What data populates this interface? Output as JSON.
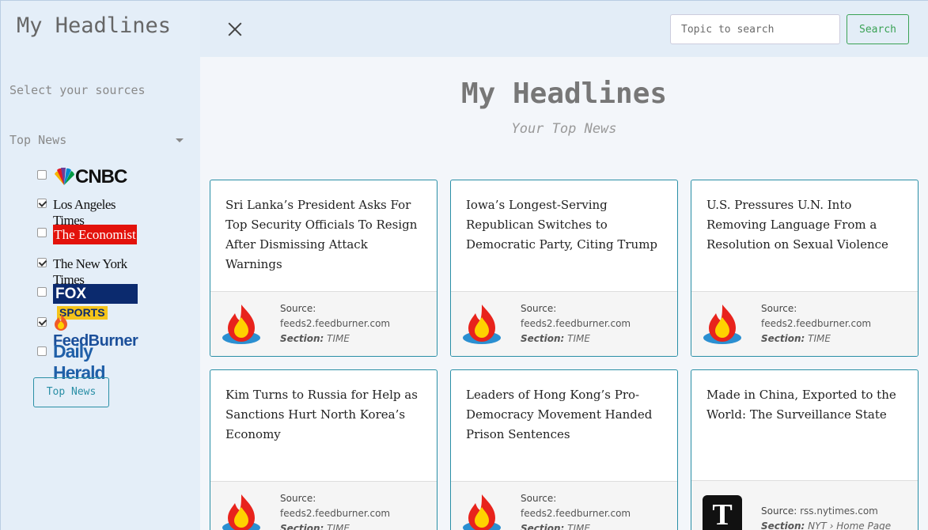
{
  "sidebar": {
    "title": "My Headlines",
    "subtitle": "Select your sources",
    "category": "Top News",
    "sources": [
      {
        "name": "CNBC",
        "checked": false
      },
      {
        "name": "Los Angeles Times",
        "checked": true
      },
      {
        "name": "The Economist",
        "checked": false
      },
      {
        "name": "The New York Times",
        "checked": true
      },
      {
        "name": "FOX SPORTS",
        "checked": false
      },
      {
        "name": "FeedBurner",
        "checked": true
      },
      {
        "name": "Daily Herald",
        "checked": false
      }
    ],
    "button_label": "Top News"
  },
  "header": {
    "search_placeholder": "Topic to search",
    "search_button": "Search"
  },
  "main": {
    "title": "My Headlines",
    "subtitle": "Your Top News"
  },
  "labels": {
    "source": "Source:",
    "section": "Section:"
  },
  "cards": [
    {
      "title": "Sri Lanka’s President Asks For Top Security Officials To Resign After Dismissing Attack Warnings",
      "source": "feeds2.feedburner.com",
      "section": "TIME",
      "icon": "feedburner-icon"
    },
    {
      "title": "Iowa’s Longest-Serving Republican Switches to Democratic Party, Citing Trump",
      "source": "feeds2.feedburner.com",
      "section": "TIME",
      "icon": "feedburner-icon"
    },
    {
      "title": "U.S. Pressures U.N. Into Removing Language From a Resolution on Sexual Violence",
      "source": "feeds2.feedburner.com",
      "section": "TIME",
      "icon": "feedburner-icon"
    },
    {
      "title": "Kim Turns to Russia for Help as Sanctions Hurt North Korea’s Economy",
      "source": "feeds2.feedburner.com",
      "section": "TIME",
      "icon": "feedburner-icon"
    },
    {
      "title": "Leaders of Hong Kong’s Pro-Democracy Movement Handed Prison Sentences",
      "source": "feeds2.feedburner.com",
      "section": "TIME",
      "icon": "feedburner-icon"
    },
    {
      "title": "Made in China, Exported to the World: The Surveillance State",
      "source": "rss.nytimes.com",
      "section": "NYT › Home Page",
      "icon": "nyt-icon"
    }
  ],
  "colors": {
    "accent": "#2a8fa6",
    "search_green": "#3aa255",
    "sidebar_bg": "#e4eef8"
  }
}
